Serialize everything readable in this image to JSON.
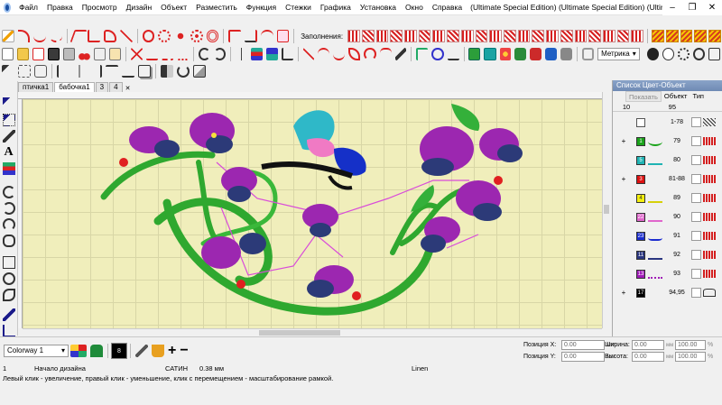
{
  "window": {
    "title": "(Ultimate Special Edition) (Ultimate Special Edition) (Ultimate Special Edition) (Ultimate Special Edition) (Ultimate Special Editi",
    "menu": [
      "Файл",
      "Правка",
      "Просмотр",
      "Дизайн",
      "Объект",
      "Разместить",
      "Функция",
      "Стежки",
      "Графика",
      "Установка",
      "Окно",
      "Справка"
    ]
  },
  "toolbar": {
    "fills_label": "Заполнения:",
    "units_value": "Метрика"
  },
  "tabs": [
    {
      "label": "птичка1"
    },
    {
      "label": "бабочка1"
    },
    {
      "label": "3"
    },
    {
      "label": "4"
    }
  ],
  "panel": {
    "title": "Список Цвет-Объект",
    "show_button": "Показать",
    "col_object": "Объект",
    "col_type": "Тип",
    "header_left": "10",
    "header_right": "95",
    "rows": [
      {
        "plus": "",
        "color": "#ffffff",
        "label": "",
        "num": "1-78"
      },
      {
        "plus": "+",
        "color": "#1aa31a",
        "label": "1",
        "num": "79"
      },
      {
        "plus": "",
        "color": "#1fb3b3",
        "label": "5",
        "num": "80"
      },
      {
        "plus": "+",
        "color": "#dd1111",
        "label": "3",
        "num": "81-88"
      },
      {
        "plus": "",
        "color": "#f4ef0e",
        "label": "4",
        "num": "89"
      },
      {
        "plus": "",
        "color": "#e066cc",
        "label": "22",
        "num": "90"
      },
      {
        "plus": "",
        "color": "#1b2ccf",
        "label": "23",
        "num": "91"
      },
      {
        "plus": "",
        "color": "#2a3680",
        "label": "11",
        "num": "92"
      },
      {
        "plus": "",
        "color": "#a01bb8",
        "label": "13",
        "num": "93"
      },
      {
        "plus": "+",
        "color": "#000000",
        "label": "17",
        "num": "94,95"
      }
    ]
  },
  "bottom": {
    "colorway": "Colorway 1",
    "swatch_number": "8",
    "pos_x_label": "Позиция X:",
    "pos_y_label": "Позиция Y:",
    "pos_x": "0.00",
    "pos_y": "0.00",
    "unit_mm": "мм",
    "width_label": "Ширина:",
    "height_label": "Высота:",
    "width": "0.00",
    "height": "0.00",
    "width_pct": "100.00",
    "height_pct": "100.00",
    "pct": "%"
  },
  "status": {
    "index": "1",
    "design_start": "Начало дизайна",
    "stitch_type": "САТИН",
    "stitch_size": "0.38 мм",
    "fabric": "Linen",
    "hint": "Левый клик - увеличение, правый клик - уменьшение, клик с перемещением - масштабирование рамкой."
  }
}
